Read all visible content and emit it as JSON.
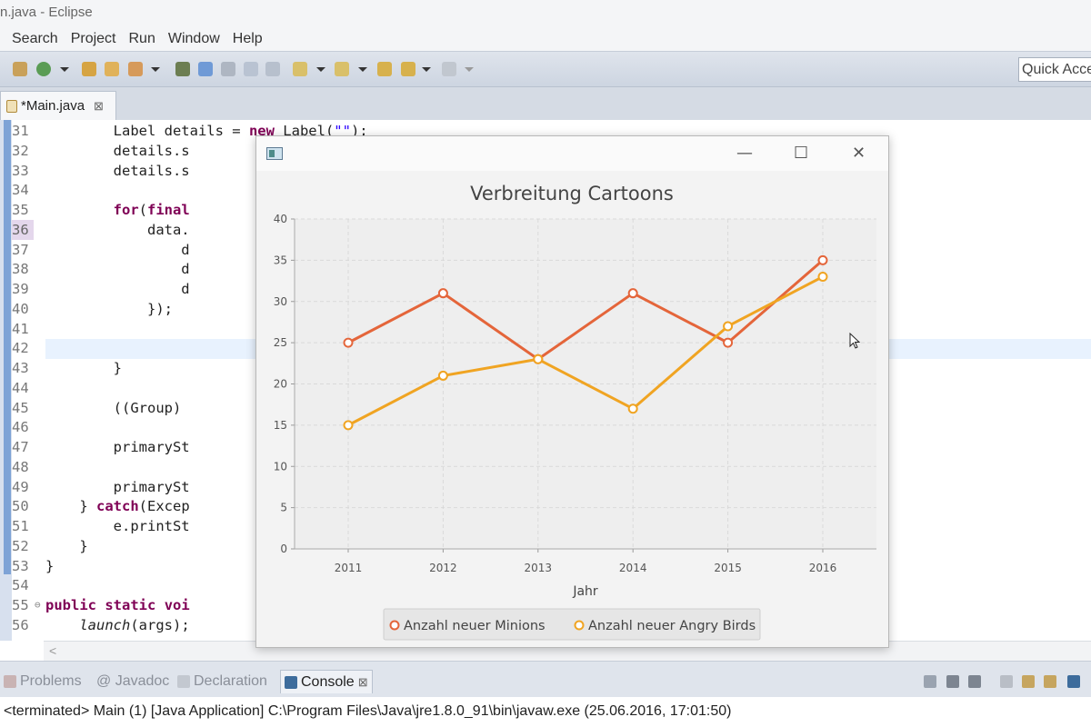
{
  "window": {
    "title": "n.java - Eclipse"
  },
  "menu": [
    "Search",
    "Project",
    "Run",
    "Window",
    "Help"
  ],
  "toolbar": {
    "quick_access": "Quick Acce"
  },
  "editor_tab": {
    "label": "*Main.java",
    "close": "⊠"
  },
  "code": [
    {
      "n": "31",
      "html": "        Label details = <span class=\"kw\">new</span> Label(<span class=\"str\">\"\"</span>);"
    },
    {
      "n": "32",
      "html": "        details.s"
    },
    {
      "n": "33",
      "html": "        details.s"
    },
    {
      "n": "34",
      "html": ""
    },
    {
      "n": "35",
      "html": "        <span class=\"kw\">for</span>(<span class=\"kw\">final</span>"
    },
    {
      "n": "36",
      "html": "            data.",
      "active": true
    },
    {
      "n": "37",
      "html": "                d"
    },
    {
      "n": "38",
      "html": "                d"
    },
    {
      "n": "39",
      "html": "                d"
    },
    {
      "n": "40",
      "html": "            });"
    },
    {
      "n": "41",
      "html": ""
    },
    {
      "n": "42",
      "html": ""
    },
    {
      "n": "43",
      "html": "        }"
    },
    {
      "n": "44",
      "html": ""
    },
    {
      "n": "45",
      "html": "        ((Group)"
    },
    {
      "n": "46",
      "html": ""
    },
    {
      "n": "47",
      "html": "        primarySt"
    },
    {
      "n": "48",
      "html": ""
    },
    {
      "n": "49",
      "html": "        primarySt"
    },
    {
      "n": "50",
      "html": "    } <span class=\"kw\">catch</span>(Excep"
    },
    {
      "n": "51",
      "html": "        e.printSt"
    },
    {
      "n": "52",
      "html": "    }"
    },
    {
      "n": "53",
      "html": "}"
    },
    {
      "n": "54",
      "html": ""
    },
    {
      "n": "55",
      "html": "<span class=\"kw\">public</span> <span class=\"kw\">static</span> <span class=\"kw\">voi</span>",
      "fold": "⊖"
    },
    {
      "n": "56",
      "html": "    <span class=\"it\">launch</span>(args);"
    }
  ],
  "views": {
    "tabs": [
      {
        "label": "Problems"
      },
      {
        "label": "@ Javadoc"
      },
      {
        "label": "Declaration"
      },
      {
        "label": "Console",
        "close": "⊠"
      }
    ],
    "console_text": "<terminated> Main (1) [Java Application] C:\\Program Files\\Java\\jre1.8.0_91\\bin\\javaw.exe (25.06.2016, 17:01:50)"
  },
  "chart_window": {
    "controls": {
      "minimize": "—",
      "maximize": "☐",
      "close": "✕"
    }
  },
  "colors": {
    "minions": "#e4653a",
    "angry_birds": "#f0a422"
  },
  "chart_data": {
    "type": "line",
    "title": "Verbreitung Cartoons",
    "xlabel": "Jahr",
    "ylabel": "",
    "categories": [
      "2011",
      "2012",
      "2013",
      "2014",
      "2015",
      "2016"
    ],
    "ylim": [
      0,
      40
    ],
    "yticks": [
      "0",
      "5",
      "10",
      "15",
      "20",
      "25",
      "30",
      "35",
      "40"
    ],
    "series": [
      {
        "name": "Anzahl neuer Minions",
        "values": [
          25,
          31,
          23,
          31,
          25,
          35
        ]
      },
      {
        "name": "Anzahl neuer Angry Birds",
        "values": [
          15,
          21,
          23,
          17,
          27,
          33
        ]
      }
    ],
    "grid": true,
    "legend": "bottom"
  }
}
